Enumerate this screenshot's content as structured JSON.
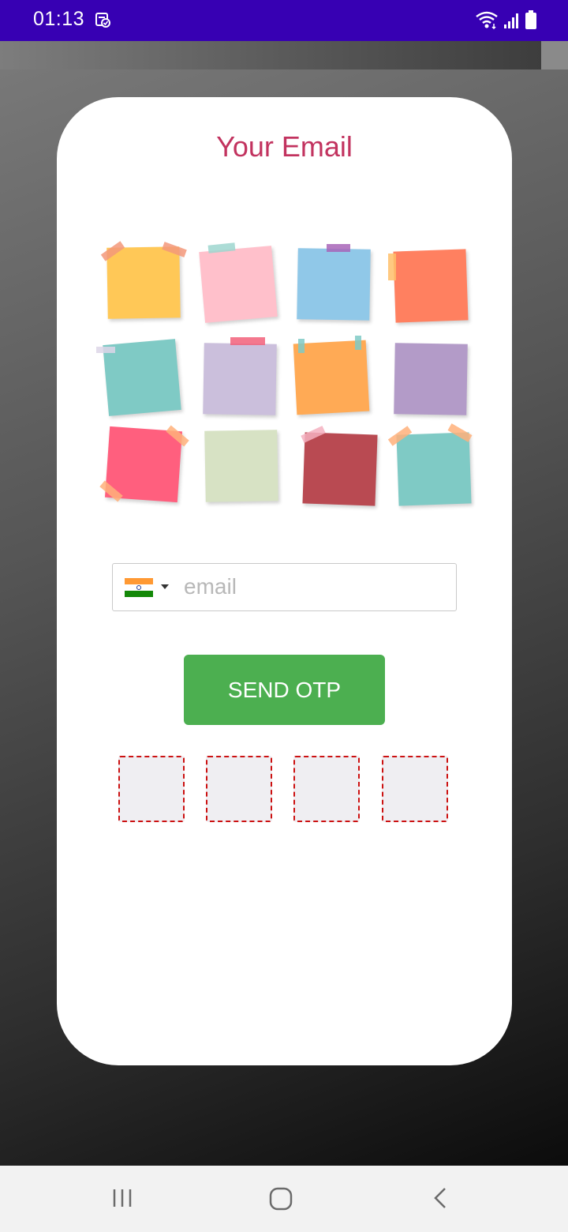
{
  "status_bar": {
    "time": "01:13",
    "icons": [
      "note-check-icon",
      "wifi-icon",
      "signal-icon",
      "battery-icon"
    ]
  },
  "screen": {
    "title": "Your Email",
    "title_color": "#c2335f",
    "illustration": "sticky-notes-illustration"
  },
  "email_field": {
    "flag": "india-flag-icon",
    "value": "",
    "placeholder": "email"
  },
  "send_button": {
    "label": "SEND OTP",
    "color": "#4caf50"
  },
  "otp": {
    "digits": [
      "",
      "",
      "",
      ""
    ],
    "border_color": "#cc1111"
  },
  "navigation_bar": {
    "buttons": [
      "recents-icon",
      "home-icon",
      "back-icon"
    ]
  },
  "colors": {
    "status_bar": "#3700b3"
  }
}
